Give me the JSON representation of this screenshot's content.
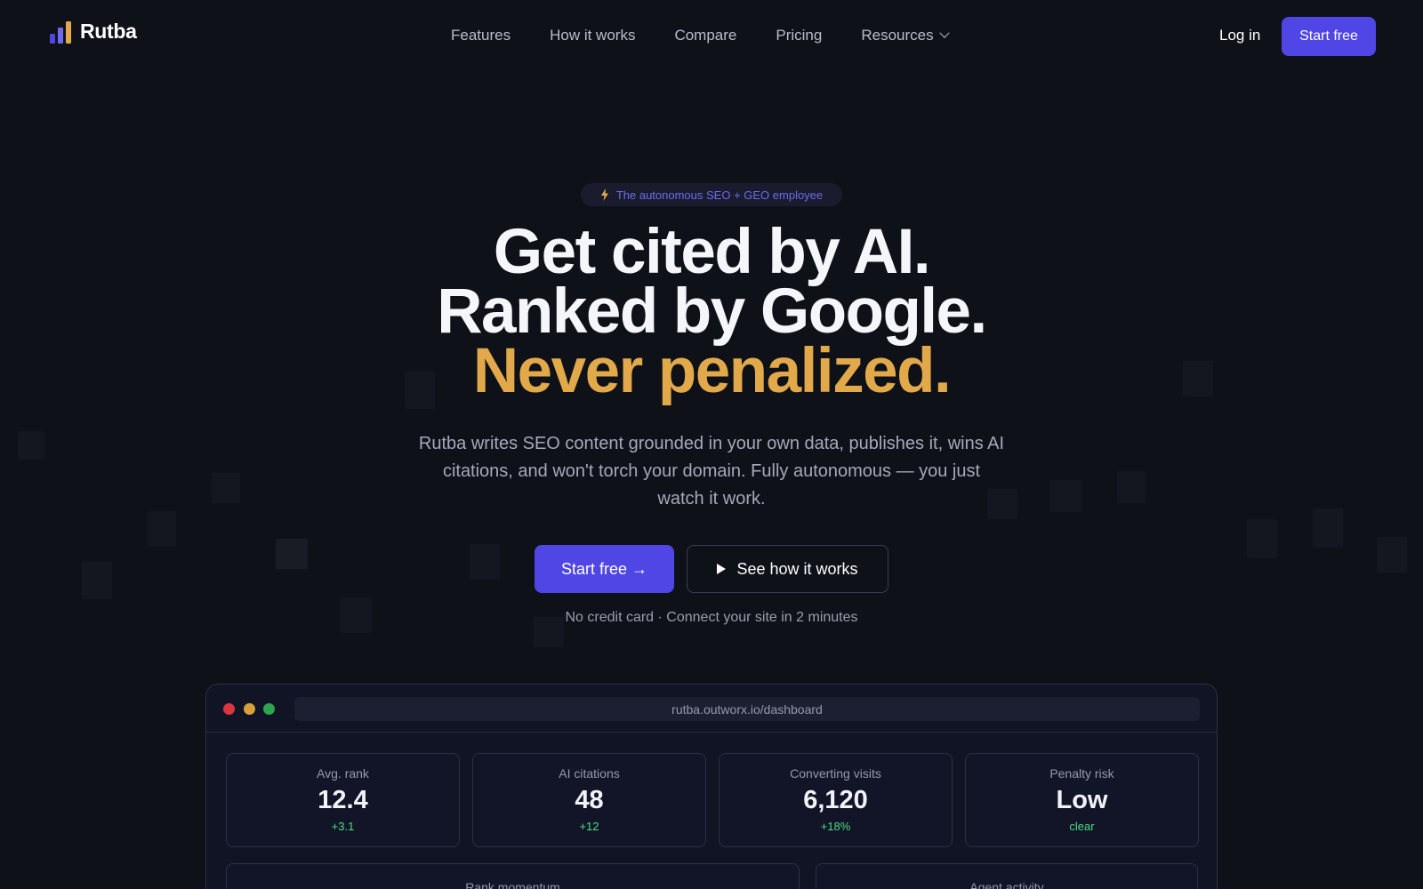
{
  "brand": {
    "name": "Rutba",
    "logo_colors": [
      "#4f46e5",
      "#6d6af0",
      "#e2a94a"
    ]
  },
  "nav": {
    "links": [
      {
        "label": "Features"
      },
      {
        "label": "How it works"
      },
      {
        "label": "Compare"
      },
      {
        "label": "Pricing"
      },
      {
        "label": "Resources",
        "icon": "chevron-down-icon"
      }
    ],
    "login_label": "Log in",
    "start_label": "Start free"
  },
  "hero": {
    "badge": "The autonomous SEO + GEO employee",
    "badge_icon": "lightning-icon",
    "headline_line1": "Get cited by AI.",
    "headline_line2": "Ranked by Google.",
    "headline_line3": "Never penalized.",
    "subtitle": "Rutba writes SEO content grounded in your own data, publishes it, wins AI citations, and won't torch your domain. Fully autonomous — you just watch it work.",
    "cta_primary": "Start free →",
    "cta_secondary": "See how it works",
    "cta_secondary_icon": "play-icon",
    "note": "No credit card · Connect your site in 2 minutes"
  },
  "dashboard": {
    "url": "rutba.outworx.io/dashboard",
    "window_dots": [
      "#d9363e",
      "#d6a03a",
      "#2ea44f"
    ],
    "stats": [
      {
        "label": "Avg. rank",
        "value": "12.4",
        "delta": "+3.1"
      },
      {
        "label": "AI citations",
        "value": "48",
        "delta": "+12"
      },
      {
        "label": "Converting visits",
        "value": "6,120",
        "delta": "+18%"
      },
      {
        "label": "Penalty risk",
        "value": "Low",
        "delta": "clear"
      }
    ],
    "panels": [
      {
        "title": "Rank momentum"
      },
      {
        "title": "Agent activity"
      }
    ]
  },
  "colors": {
    "background": "#0f1119",
    "accent": "#4f46e5",
    "highlight": "#e2a94a",
    "positive": "#4ade80"
  }
}
